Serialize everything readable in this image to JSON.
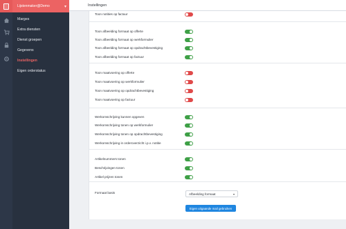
{
  "sidebar": {
    "account_name": "Lijstenmaker@Demo",
    "chevron": "▾",
    "items": [
      {
        "label": "Marges",
        "icon": "home-icon"
      },
      {
        "label": "Extra diensten",
        "icon": "cart-icon"
      },
      {
        "label": "Dienst groepen",
        "icon": "lock-icon"
      },
      {
        "label": "Gegevens",
        "icon": "settings-icon"
      },
      {
        "label": "Instellingen",
        "icon": "",
        "active": true
      },
      {
        "label": "Eigen orderstatus",
        "icon": ""
      }
    ]
  },
  "header": {
    "title": "Instellingen"
  },
  "settings": [
    {
      "label": "Toon notities op factuur",
      "on": false
    },
    {
      "label": "Toon afbeelding formaat op offerte",
      "on": true
    },
    {
      "label": "Toon afbeelding formaat op werkformulier",
      "on": true
    },
    {
      "label": "Toon afbeelding formaat op opdrachtbevestiging",
      "on": true
    },
    {
      "label": "Toon afbeelding formaat op factuur",
      "on": true
    },
    {
      "label": "Toon maatvoering op offerte",
      "on": false
    },
    {
      "label": "Toon maatvoering op werkformulier",
      "on": false
    },
    {
      "label": "Toon maatvoering op opdrachtbevestiging",
      "on": false
    },
    {
      "label": "Toon maatvoering op factuur",
      "on": false
    },
    {
      "label": "Werkomschrijving kunnen opgeven",
      "on": true
    },
    {
      "label": "Werkomschrijving tonen op werkformulier",
      "on": true
    },
    {
      "label": "Werkomschrijving tonen op opdrachtbevestiging",
      "on": true
    },
    {
      "label": "Werkomschrijving in orderoverzicht i.p.v. notitie",
      "on": true
    },
    {
      "label": "Artikelnummers tonen",
      "on": true
    },
    {
      "label": "Beschrijvingen tonen",
      "on": true
    },
    {
      "label": "Artikel prijzen tonen",
      "on": true
    }
  ],
  "format_basis": {
    "label": "Formaat basis",
    "selected": "Afbeelding formaat",
    "caret": "▾"
  },
  "save_button": {
    "label": "Eigen uitgaande mail gebruiken"
  },
  "colors": {
    "accent": "#ec6363",
    "toggle_on": "#3fa047",
    "toggle_off": "#e04a4a",
    "button": "#1f86e0"
  }
}
